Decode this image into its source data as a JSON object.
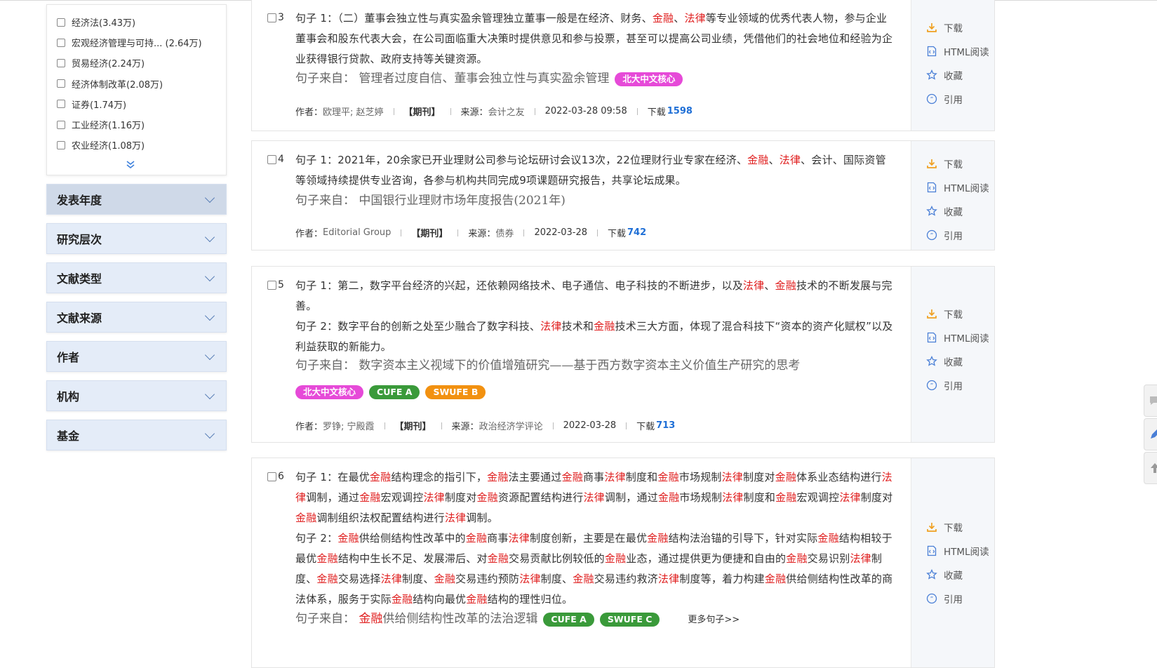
{
  "filters": {
    "subject_items": [
      {
        "label": "经济法(3.43万)"
      },
      {
        "label": "宏观经济管理与可持... (2.64万)"
      },
      {
        "label": "贸易经济(2.24万)"
      },
      {
        "label": "经济体制改革(2.08万)"
      },
      {
        "label": "证券(1.74万)"
      },
      {
        "label": "工业经济(1.16万)"
      },
      {
        "label": "农业经济(1.08万)"
      }
    ],
    "facets": [
      {
        "label": "发表年度"
      },
      {
        "label": "研究层次"
      },
      {
        "label": "文献类型"
      },
      {
        "label": "文献来源"
      },
      {
        "label": "作者"
      },
      {
        "label": "机构"
      },
      {
        "label": "基金"
      }
    ]
  },
  "actions": {
    "download": "下载",
    "html_read": "HTML阅读",
    "favorite": "收藏",
    "cite": "引用"
  },
  "labels": {
    "source_prefix": "句子来自：",
    "author": "作者：",
    "origin": "来源：",
    "download": "下载",
    "journal": "【期刊】",
    "more_sentences": "更多句子>>"
  },
  "tags": {
    "pku": "北大中文核心",
    "cufe_a": "CUFE A",
    "cufe_c": "SWUFE C",
    "swufe_b": "SWUFE B",
    "cufe_a2": "CUFE A"
  },
  "results": [
    {
      "no": "3",
      "sentence1": "句子 1：（二）董事会独立性与真实盈余管理独立董事一般是在经济、财务、金融、法律等专业领域的优秀代表人物，参与企业董事会和股东代表大会，在公司面临重大决策时提供意见和参与投票，甚至可以提高公司业绩，凭借他们的社会地位和经验为企业获得银行贷款、政府支持等关键资源。",
      "source_title": "管理者过度自信、董事会独立性与真实盈余管理",
      "author": "欧理平; 赵芝婷",
      "origin": "会计之友",
      "date": "2022-03-28 09:58",
      "downloads": "1598"
    },
    {
      "no": "4",
      "sentence1": "句子 1：2021年，20余家已开业理财公司参与论坛研讨会议13次，22位理财行业专家在经济、金融、法律、会计、国际资管等领域持续提供专业咨询，各参与机构共同完成9项课题研究报告，共享论坛成果。",
      "source_title": "中国银行业理财市场年度报告(2021年)",
      "author": "Editorial Group",
      "origin": "债券",
      "date": "2022-03-28",
      "downloads": "742"
    },
    {
      "no": "5",
      "sentence1": "句子 1：第二，数字平台经济的兴起，还依赖网络技术、电子通信、电子科技的不断进步，以及法律、金融技术的不断发展与完善。",
      "sentence2": "句子 2：数字平台的创新之处至少融合了数字科技、法律技术和金融技术三大方面，体现了混合科技下“资本的资产化赋权”以及利益获取的新能力。",
      "source_title": "数字资本主义视域下的价值增殖研究——基于西方数字资本主义价值生产研究的思考",
      "author": "罗铮; 宁殿霞",
      "origin": "政治经济学评论",
      "date": "2022-03-28",
      "downloads": "713"
    },
    {
      "no": "6",
      "sentence1": "句子 1：在最优金融结构理念的指引下，金融法主要通过金融商事法律制度和金融市场规制法律制度对金融体系业态结构进行法律调制，通过金融宏观调控法律制度对金融资源配置结构进行法律调制，通过金融市场规制法律制度和金融宏观调控法律制度对金融调制组织法权配置结构进行法律调制。",
      "sentence2": "句子 2：金融供给侧结构性改革中的金融商事法律制度创新，主要是在最优金融结构法治锚的引导下，针对实际金融结构相较于最优金融结构中生长不足、发展滞后、对金融交易贡献比例较低的金融业态，通过提供更为便捷和自由的金融交易识别法律制度、金融交易选择法律制度、金融交易违约预防法律制度、金融交易违约救济法律制度等，着力构建金融供给侧结构性改革的商法体系，服务于实际金融结构向最优金融结构的理性归位。",
      "source_title": "金融供给侧结构性改革的法治逻辑"
    }
  ]
}
